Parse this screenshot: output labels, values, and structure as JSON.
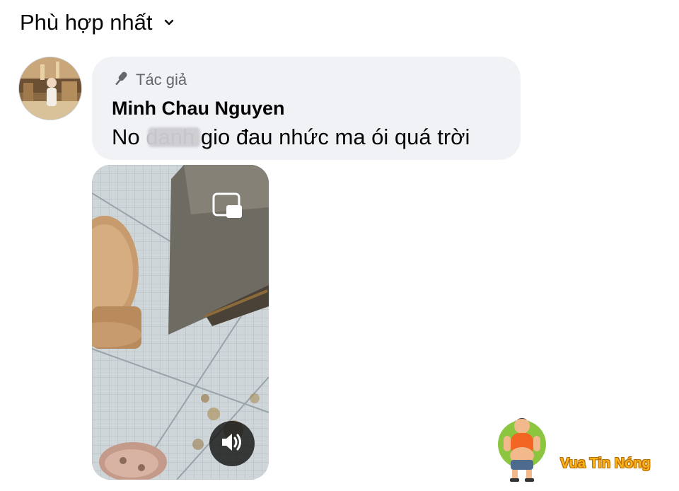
{
  "sort": {
    "label": "Phù hợp nhất",
    "icon": "chevron-down-icon"
  },
  "comment": {
    "avatar_icon": "user-avatar",
    "badge_icon": "microphone-icon",
    "badge_label": "Tác giả",
    "author": "Minh Chau Nguyen",
    "text_before": "No ",
    "text_redacted": "danh",
    "text_after": " gio đau nhức ma ói quá trời"
  },
  "video": {
    "pip_icon": "picture-in-picture-icon",
    "sound_icon": "speaker-volume-icon"
  },
  "watermark": {
    "logo_text": "Vua Tin Nóng"
  },
  "colors": {
    "bubble_bg": "#f0f2f5",
    "secondary_text": "#65676b",
    "watermark_text": "#f7b319"
  }
}
